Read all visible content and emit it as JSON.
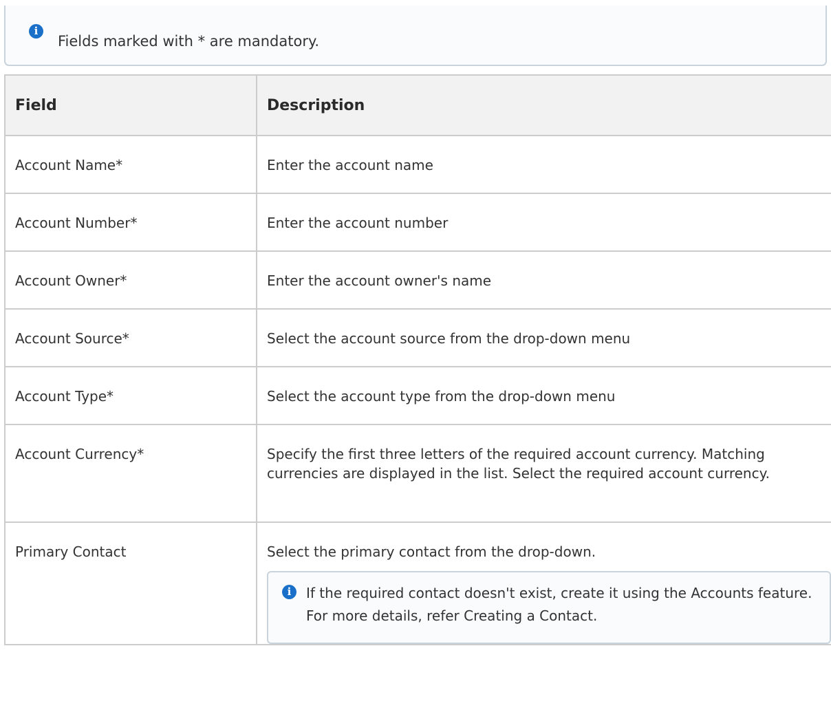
{
  "top_note": {
    "icon": "info-icon",
    "icon_glyph": "i",
    "text": "Fields marked with * are mandatory."
  },
  "table": {
    "headers": [
      "Field",
      "Description"
    ],
    "rows": [
      {
        "field": "Account Name*",
        "description": "Enter the account name"
      },
      {
        "field": "Account Number*",
        "description": "Enter the account number"
      },
      {
        "field": "Account Owner*",
        "description": "Enter the account owner's name"
      },
      {
        "field": "Account Source*",
        "description": "Select the account source from the drop-down menu"
      },
      {
        "field": "Account Type*",
        "description": "Select the account type from the drop-down menu"
      },
      {
        "field": "Account Currency*",
        "description": "Specify the first three letters of the required account currency. Matching currencies are displayed in the list. Select the required account currency."
      },
      {
        "field": "Primary Contact",
        "description": "Select the primary contact from the drop-down."
      }
    ],
    "inline_note": {
      "icon": "info-icon",
      "icon_glyph": "i",
      "text": "If the required contact doesn't exist, create it using the Accounts feature. For more details, refer Creating a Contact."
    }
  },
  "colors": {
    "icon_blue": "#1a6fc9",
    "border": "#cccccc",
    "header_bg": "#f2f2f2",
    "note_border": "#c9d3dc"
  }
}
